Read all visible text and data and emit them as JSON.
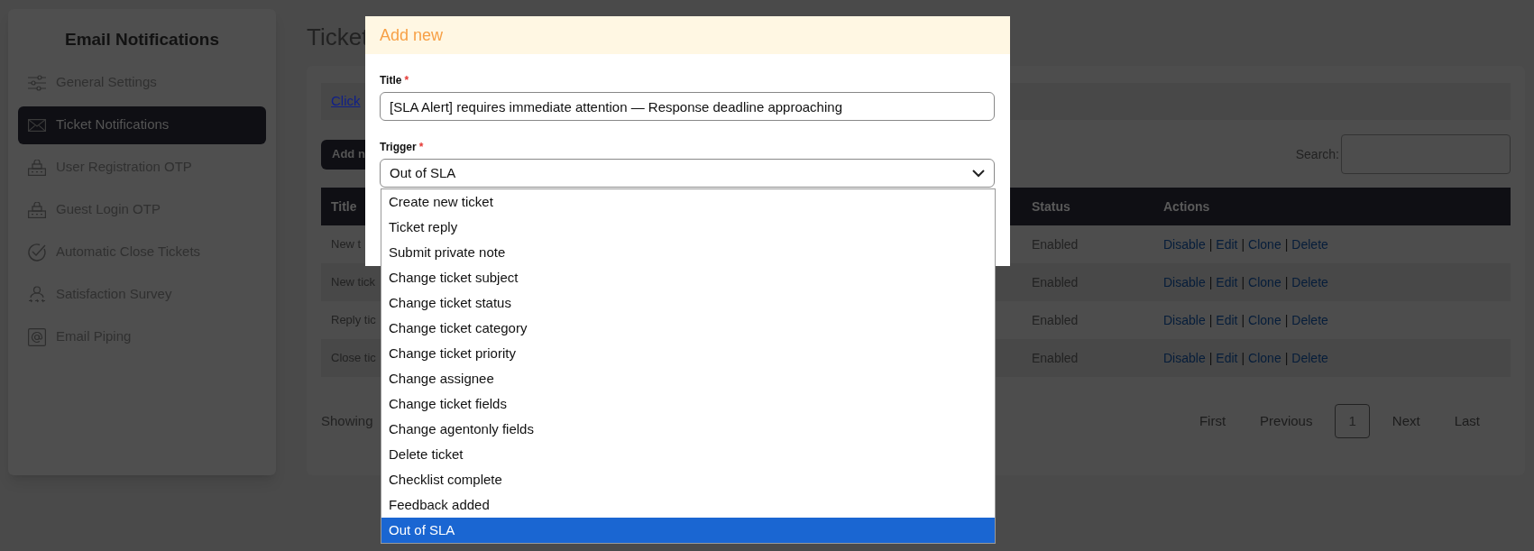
{
  "sidebar": {
    "title": "Email Notifications",
    "items": [
      {
        "label": "General Settings",
        "selected": false
      },
      {
        "label": "Ticket Notifications",
        "selected": true
      },
      {
        "label": "User Registration OTP",
        "selected": false
      },
      {
        "label": "Guest Login OTP",
        "selected": false
      },
      {
        "label": "Automatic Close Tickets",
        "selected": false
      },
      {
        "label": "Satisfaction Survey",
        "selected": false
      },
      {
        "label": "Email Piping",
        "selected": false
      }
    ]
  },
  "page": {
    "title": "Ticket",
    "notice_link": "Click",
    "add_button": "Add n",
    "search_label": "Search:"
  },
  "table": {
    "columns": [
      "Title",
      "Status",
      "Actions"
    ],
    "rows": [
      {
        "title": "New t",
        "status": "Enabled",
        "actions": [
          {
            "kind": "link",
            "text": "Disable"
          },
          {
            "kind": "separator",
            "text": "|"
          },
          {
            "kind": "link",
            "text": "Edit"
          },
          {
            "kind": "separator",
            "text": "|"
          },
          {
            "kind": "link",
            "text": "Clone"
          },
          {
            "kind": "separator",
            "text": "|"
          },
          {
            "kind": "link",
            "text": "Delete"
          }
        ]
      },
      {
        "title": "New tick",
        "status": "Enabled",
        "actions": [
          {
            "kind": "link",
            "text": "Disable"
          },
          {
            "kind": "separator",
            "text": "|"
          },
          {
            "kind": "link",
            "text": "Edit"
          },
          {
            "kind": "separator",
            "text": "|"
          },
          {
            "kind": "link",
            "text": "Clone"
          },
          {
            "kind": "separator",
            "text": "|"
          },
          {
            "kind": "link",
            "text": "Delete"
          }
        ]
      },
      {
        "title": "Reply tic",
        "status": "Enabled",
        "actions": [
          {
            "kind": "link",
            "text": "Disable"
          },
          {
            "kind": "separator",
            "text": "|"
          },
          {
            "kind": "link",
            "text": "Edit"
          },
          {
            "kind": "separator",
            "text": "|"
          },
          {
            "kind": "link",
            "text": "Clone"
          },
          {
            "kind": "separator",
            "text": "|"
          },
          {
            "kind": "link",
            "text": "Delete"
          }
        ]
      },
      {
        "title": "Close tic",
        "status": "Enabled",
        "actions": [
          {
            "kind": "link",
            "text": "Disable"
          },
          {
            "kind": "separator",
            "text": "|"
          },
          {
            "kind": "link",
            "text": "Edit"
          },
          {
            "kind": "separator",
            "text": "|"
          },
          {
            "kind": "link",
            "text": "Clone"
          },
          {
            "kind": "separator",
            "text": "|"
          },
          {
            "kind": "link",
            "text": "Delete"
          }
        ]
      }
    ]
  },
  "footer": {
    "showing": "Showing",
    "pagination": [
      {
        "label": "First",
        "selected": false
      },
      {
        "label": "Previous",
        "selected": false
      },
      {
        "label": "1",
        "selected": true
      },
      {
        "label": "Next",
        "selected": false
      },
      {
        "label": "Last",
        "selected": false
      }
    ]
  },
  "modal": {
    "title": "Add new",
    "title_field": {
      "label": "Title",
      "required_mark": "*",
      "value": "[SLA Alert] requires immediate attention — Response deadline approaching"
    },
    "trigger_field": {
      "label": "Trigger",
      "required_mark": "*",
      "value": "Out of SLA",
      "options": [
        {
          "label": "Create new ticket",
          "selected": false
        },
        {
          "label": "Ticket reply",
          "selected": false
        },
        {
          "label": "Submit private note",
          "selected": false
        },
        {
          "label": "Change ticket subject",
          "selected": false
        },
        {
          "label": "Change ticket status",
          "selected": false
        },
        {
          "label": "Change ticket category",
          "selected": false
        },
        {
          "label": "Change ticket priority",
          "selected": false
        },
        {
          "label": "Change assignee",
          "selected": false
        },
        {
          "label": "Change ticket fields",
          "selected": false
        },
        {
          "label": "Change agentonly fields",
          "selected": false
        },
        {
          "label": "Delete ticket",
          "selected": false
        },
        {
          "label": "Checklist complete",
          "selected": false
        },
        {
          "label": "Feedback added",
          "selected": false
        },
        {
          "label": "Out of SLA",
          "selected": true
        }
      ]
    }
  }
}
